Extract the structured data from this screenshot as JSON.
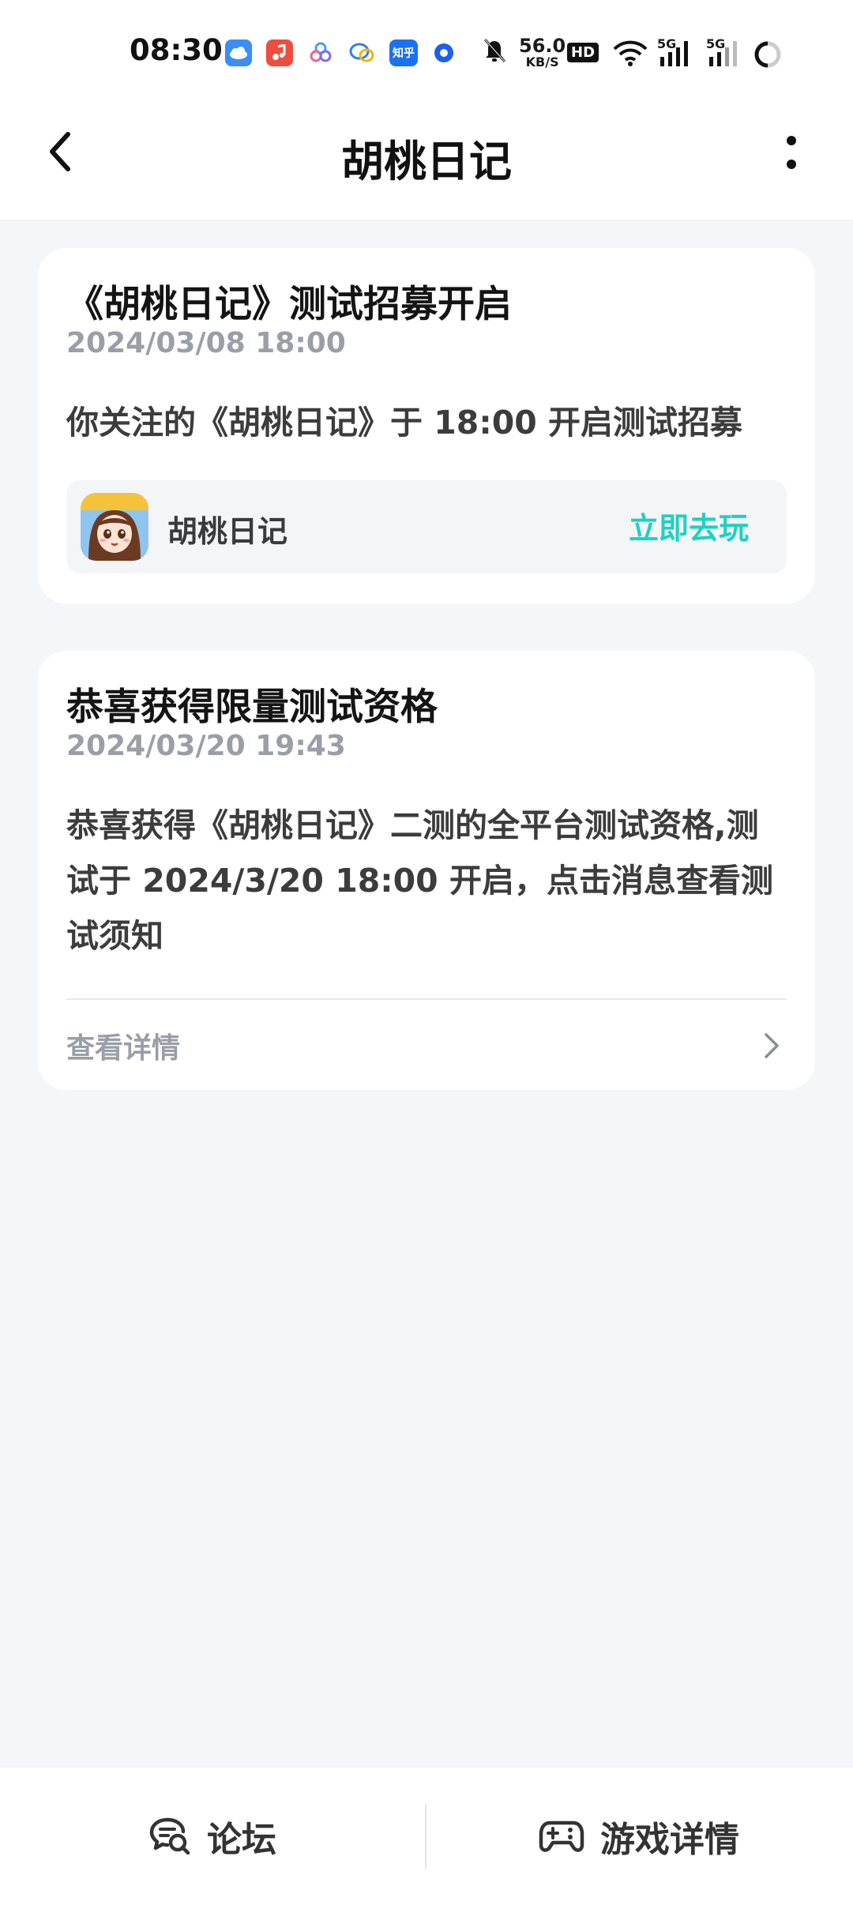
{
  "status_bar": {
    "time": "08:30",
    "net_speed_value": "56.0",
    "net_speed_unit": "KB/S",
    "hd_label": "HD",
    "signal_1": "5G",
    "signal_2": "5G",
    "zhihu_label": "知乎",
    "icons": [
      "weather-icon",
      "music-icon",
      "app-icon",
      "chat-icon",
      "zhihu-icon",
      "browser-icon",
      "mute-icon",
      "hd-icon",
      "wifi-icon",
      "signal-icon",
      "signal-icon",
      "battery-icon"
    ]
  },
  "header": {
    "title": "胡桃日记"
  },
  "cards": [
    {
      "title": "《胡桃日记》测试招募开启",
      "time": "2024/03/08  18:00",
      "body": "你关注的《胡桃日记》于 18:00 开启测试招募",
      "game": {
        "name": "胡桃日记",
        "action": "立即去玩"
      }
    },
    {
      "title": "恭喜获得限量测试资格",
      "time": "2024/03/20  19:43",
      "body": "恭喜获得《胡桃日记》二测的全平台测试资格,测试于 2024/3/20 18:00 开启，点击消息查看测试须知",
      "detail_label": "查看详情"
    }
  ],
  "bottom_bar": {
    "tabs": [
      {
        "label": "论坛",
        "icon": "forum-icon"
      },
      {
        "label": "游戏详情",
        "icon": "gamepad-icon"
      }
    ]
  },
  "colors": {
    "accent": "#1ed1c2",
    "background": "#f5f6f8",
    "muted_text": "#9a9ea6"
  }
}
